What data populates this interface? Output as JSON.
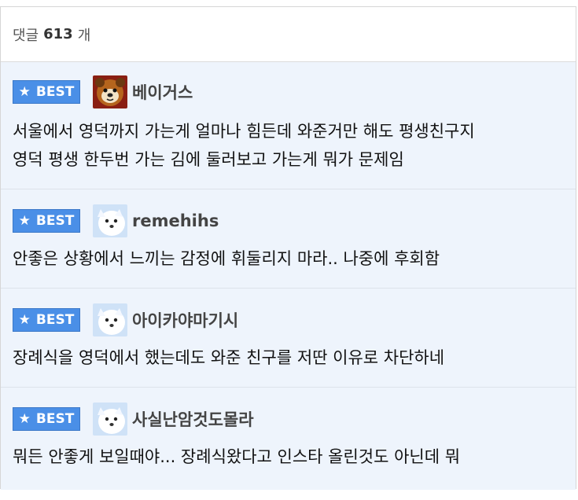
{
  "header": {
    "label": "댓글",
    "count": "613",
    "unit": "개"
  },
  "best_label": "BEST",
  "comments": [
    {
      "avatar": "bear-avatar",
      "nick": "베이거스",
      "lines": [
        "서울에서 영덕까지 가는게 얼마나 힘든데 와준거만 해도 평생친구지",
        "영덕 평생 한두번 가는 김에 둘러보고 가는게 뭐가 문제임"
      ]
    },
    {
      "avatar": "white-dog-avatar",
      "nick": "remehihs",
      "lines": [
        "안좋은 상황에서 느끼는 감정에 휘둘리지 마라.. 나중에 후회함"
      ]
    },
    {
      "avatar": "white-dog-avatar",
      "nick": "아이카야마기시",
      "lines": [
        "장례식을 영덕에서 했는데도 와준 친구를 저딴 이유로 차단하네"
      ]
    },
    {
      "avatar": "white-dog-avatar",
      "nick": "사실난암것도몰라",
      "lines": [
        "뭐든 안좋게 보일때야... 장례식왔다고 인스타 올린것도 아닌데 뭐"
      ]
    }
  ]
}
